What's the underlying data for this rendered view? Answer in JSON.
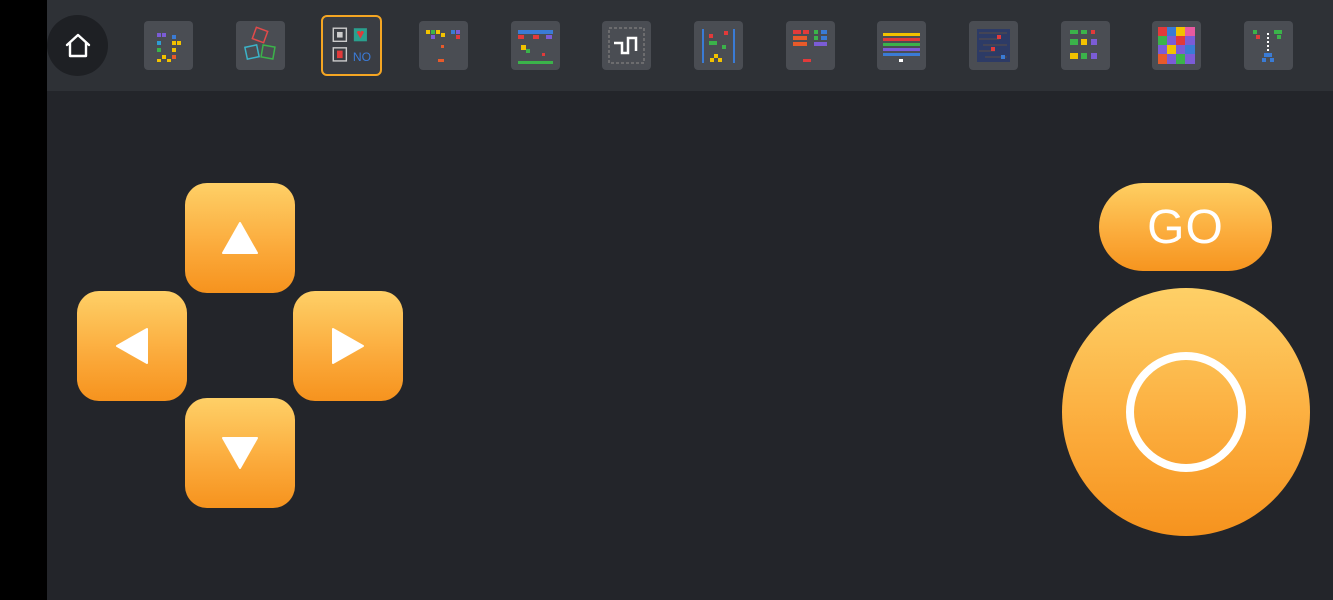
{
  "toolbar": {
    "home_icon": "home-icon",
    "games": [
      {
        "name": "tetris-game",
        "selected": false
      },
      {
        "name": "dice-game",
        "selected": false
      },
      {
        "name": "tank-battle-game",
        "selected": true
      },
      {
        "name": "brick-drop-game",
        "selected": false
      },
      {
        "name": "shooter-game",
        "selected": false
      },
      {
        "name": "snake-game",
        "selected": false
      },
      {
        "name": "racing-game",
        "selected": false
      },
      {
        "name": "block-stack-game",
        "selected": false
      },
      {
        "name": "breakout-game",
        "selected": false
      },
      {
        "name": "maze-game",
        "selected": false
      },
      {
        "name": "match-blocks-game",
        "selected": false
      },
      {
        "name": "color-puzzle-game",
        "selected": false
      },
      {
        "name": "frog-crossing-game",
        "selected": false
      }
    ],
    "selected_thumb_text": "NO"
  },
  "controls": {
    "go_label": "GO",
    "up_icon": "triangle-up-icon",
    "down_icon": "triangle-down-icon",
    "left_icon": "triangle-left-icon",
    "right_icon": "triangle-right-icon",
    "action_icon": "circle-icon"
  },
  "colors": {
    "background": "#23252a",
    "topbar": "#2e3136",
    "button_top": "#fed067",
    "button_bottom": "#f6931e",
    "selected_border": "#f5a623"
  }
}
